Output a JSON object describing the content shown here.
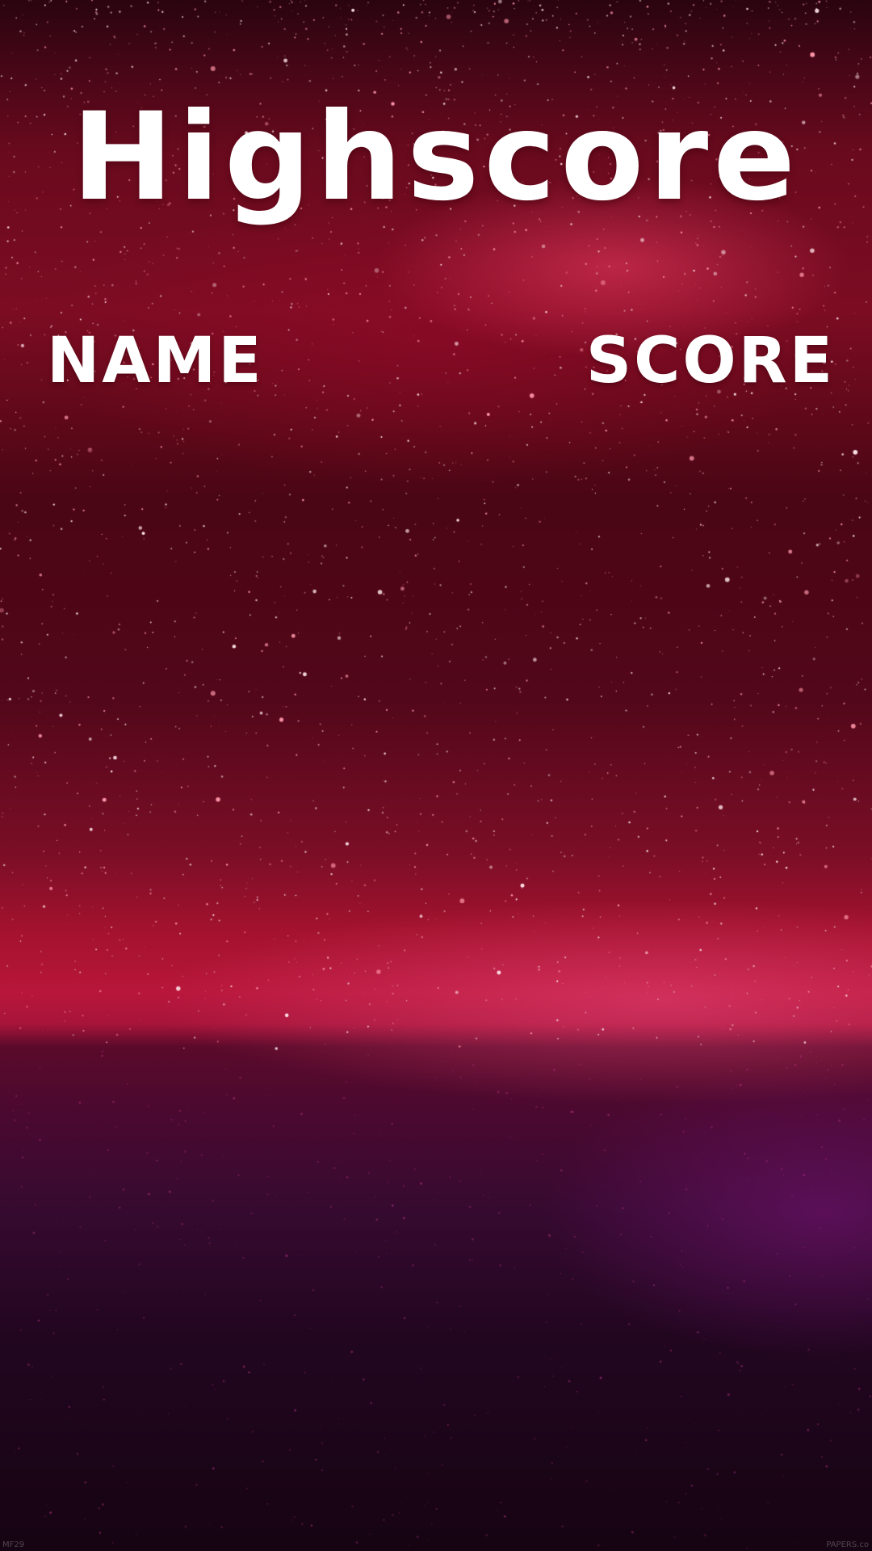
{
  "screen": {
    "title": "Highscore",
    "columns": {
      "name": "NAME",
      "score": "SCORE"
    },
    "footer": {
      "left": "MF29",
      "right": "PAPERS.co"
    }
  },
  "colors": {
    "text": "#ffffff",
    "sky_top": "#2a0410",
    "nebula": "#f03c64",
    "horizon": "#b8163a",
    "ground": "#160412"
  }
}
